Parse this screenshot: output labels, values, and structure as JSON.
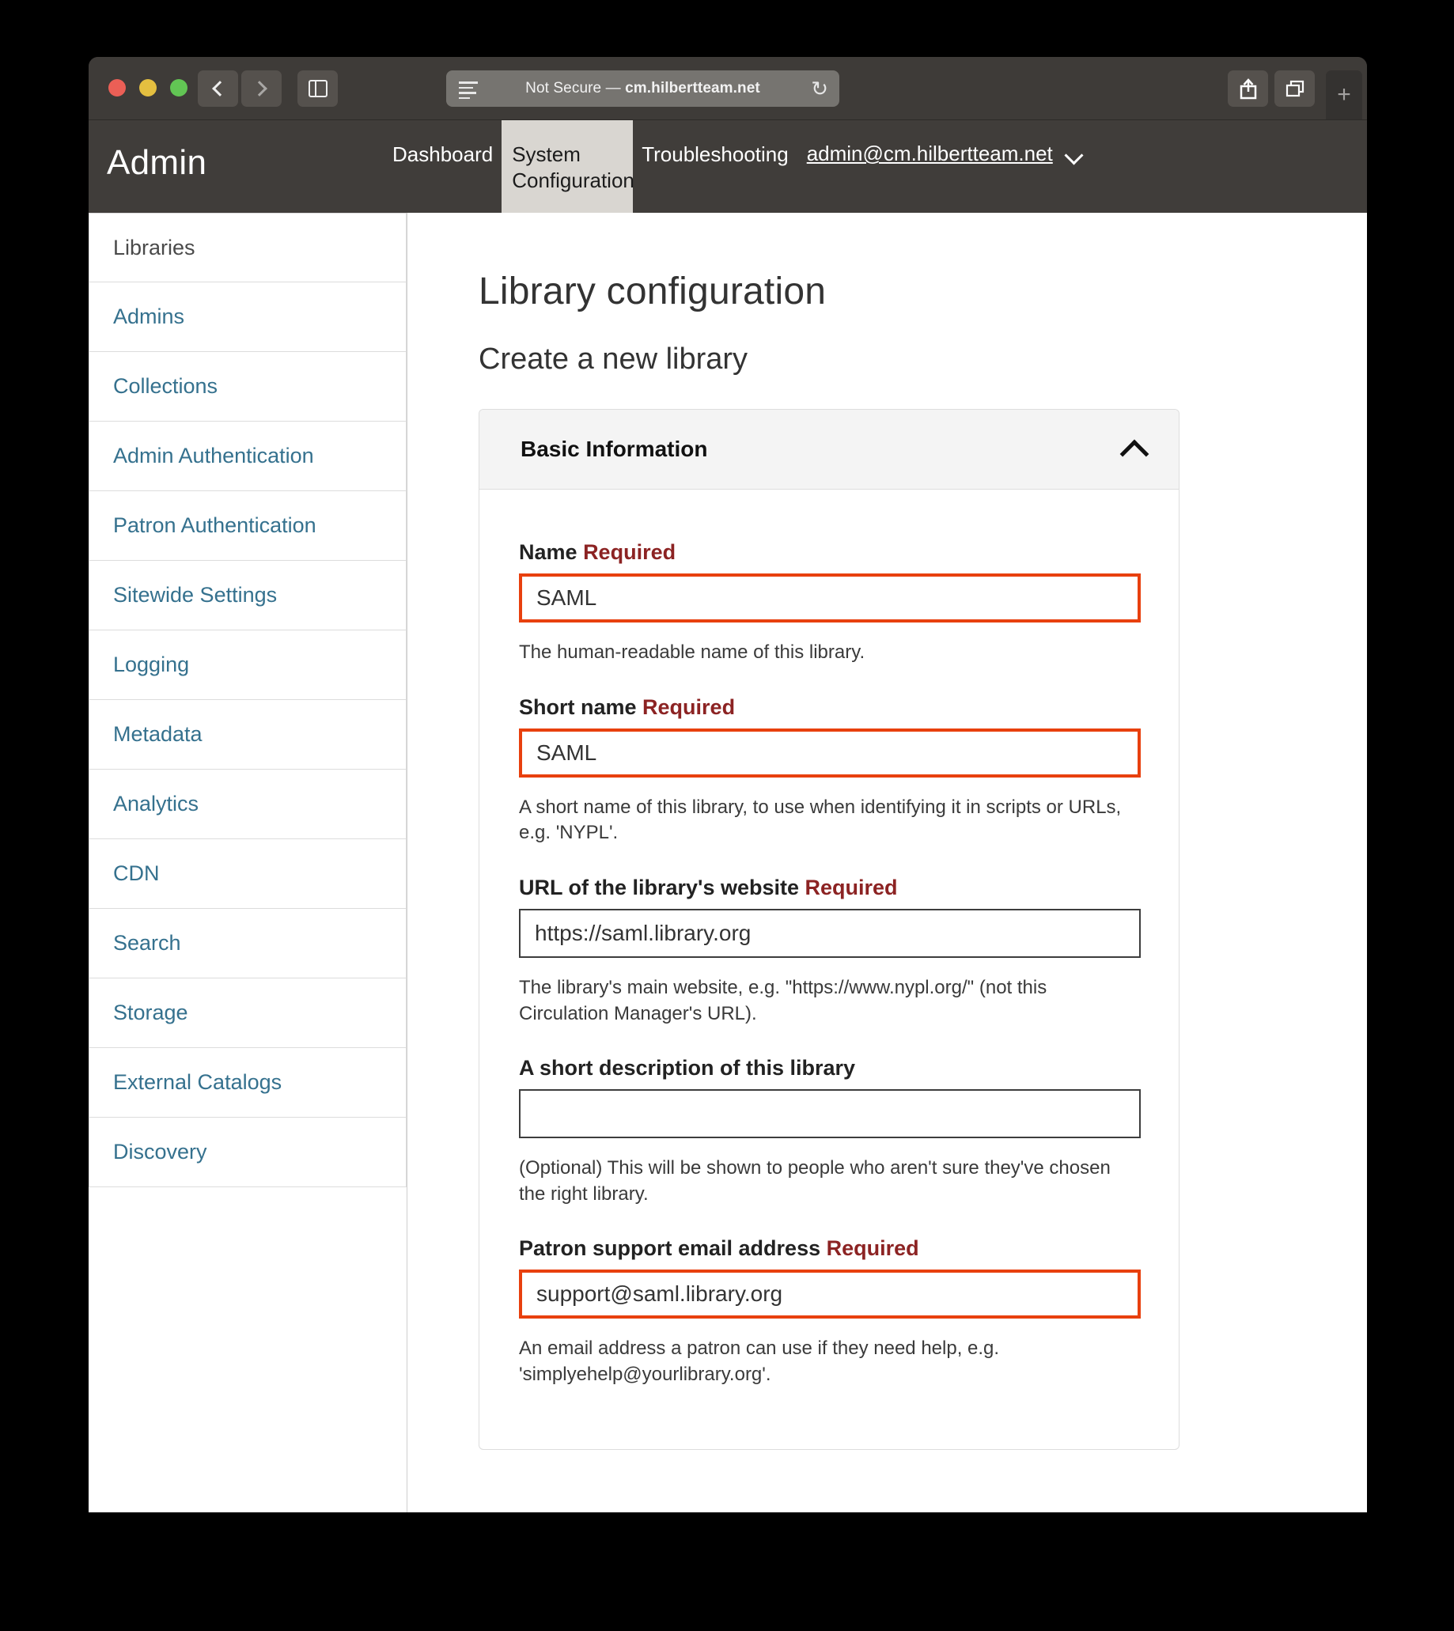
{
  "browser": {
    "traffic_lights": [
      "close",
      "minimize",
      "zoom"
    ],
    "back_label": "Back",
    "forward_label": "Forward",
    "sidebar_label": "Show sidebar",
    "reader_label": "Reader view",
    "security_text": "Not Secure",
    "separator": "—",
    "host": "cm.hilbertteam.net",
    "reload_glyph": "↻",
    "share_label": "Share",
    "tabs_label": "Show tab overview",
    "new_tab_label": "+"
  },
  "header": {
    "title": "Admin",
    "nav": [
      {
        "label": "Dashboard",
        "active": false
      },
      {
        "label": "System Configuration",
        "active": true
      },
      {
        "label": "Troubleshooting",
        "active": false
      }
    ],
    "user_email": "admin@cm.hilbertteam.net"
  },
  "sidebar": {
    "items": [
      {
        "label": "Libraries",
        "active": true
      },
      {
        "label": "Admins",
        "active": false
      },
      {
        "label": "Collections",
        "active": false
      },
      {
        "label": "Admin Authentication",
        "active": false
      },
      {
        "label": "Patron Authentication",
        "active": false
      },
      {
        "label": "Sitewide Settings",
        "active": false
      },
      {
        "label": "Logging",
        "active": false
      },
      {
        "label": "Metadata",
        "active": false
      },
      {
        "label": "Analytics",
        "active": false
      },
      {
        "label": "CDN",
        "active": false
      },
      {
        "label": "Search",
        "active": false
      },
      {
        "label": "Storage",
        "active": false
      },
      {
        "label": "External Catalogs",
        "active": false
      },
      {
        "label": "Discovery",
        "active": false
      }
    ]
  },
  "main": {
    "page_title": "Library configuration",
    "page_subtitle": "Create a new library",
    "panel": {
      "title": "Basic Information",
      "collapse_icon": "chevron-up-icon",
      "fields": [
        {
          "label": "Name",
          "required_text": "Required",
          "value": "SAML",
          "placeholder": "",
          "help": "The human-readable name of this library.",
          "error": true
        },
        {
          "label": "Short name",
          "required_text": "Required",
          "value": "SAML",
          "placeholder": "",
          "help": "A short name of this library, to use when identifying it in scripts or URLs, e.g. 'NYPL'.",
          "error": true
        },
        {
          "label": "URL of the library's website",
          "required_text": "Required",
          "value": "https://saml.library.org",
          "placeholder": "",
          "help": "The library's main website, e.g. \"https://www.nypl.org/\" (not this Circulation Manager's URL).",
          "error": false
        },
        {
          "label": "A short description of this library",
          "required_text": "",
          "value": "",
          "placeholder": "",
          "help": "(Optional) This will be shown to people who aren't sure they've chosen the right library.",
          "error": false
        },
        {
          "label": "Patron support email address",
          "required_text": "Required",
          "value": "support@saml.library.org",
          "placeholder": "",
          "help": "An email address a patron can use if they need help, e.g. 'simplyehelp@yourlibrary.org'.",
          "error": true
        }
      ]
    }
  },
  "colors": {
    "link": "#35718e",
    "error_border": "#e8400e",
    "required_text": "#8c2323",
    "chrome": "#3e3b38",
    "app_header": "#403d3a",
    "active_tab": "#d9d6d1"
  }
}
